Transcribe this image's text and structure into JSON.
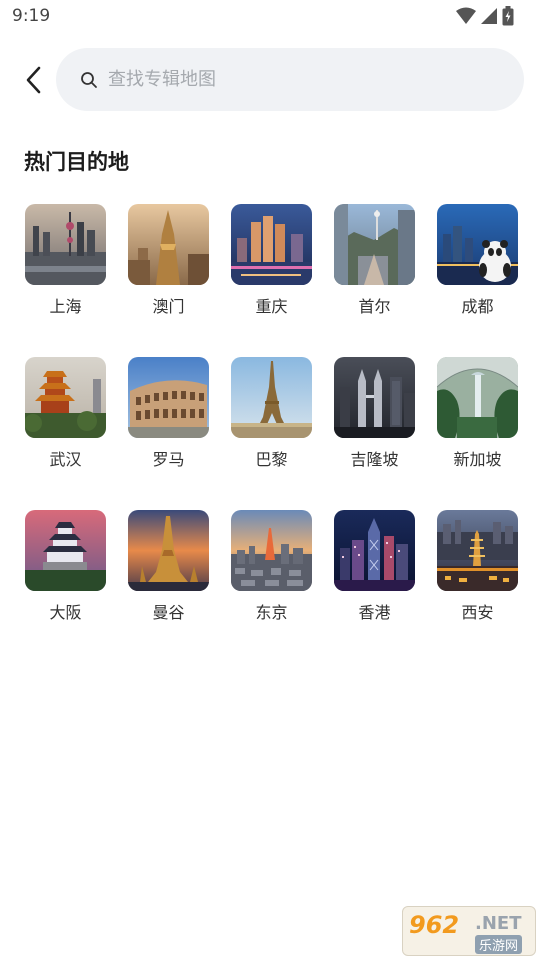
{
  "status_bar": {
    "time": "9:19"
  },
  "search": {
    "placeholder": "查找专辑地图",
    "value": ""
  },
  "section": {
    "title": "热门目的地"
  },
  "destinations": [
    {
      "name": "上海"
    },
    {
      "name": "澳门"
    },
    {
      "name": "重庆"
    },
    {
      "name": "首尔"
    },
    {
      "name": "成都"
    },
    {
      "name": "武汉"
    },
    {
      "name": "罗马"
    },
    {
      "name": "巴黎"
    },
    {
      "name": "吉隆坡"
    },
    {
      "name": "新加坡"
    },
    {
      "name": "大阪"
    },
    {
      "name": "曼谷"
    },
    {
      "name": "东京"
    },
    {
      "name": "香港"
    },
    {
      "name": "西安"
    }
  ],
  "watermark": {
    "number": "962",
    "suffix": ".NET",
    "site": "乐游网"
  },
  "colors": {
    "search_bg": "#f0f2f5",
    "placeholder": "#a5a9ae",
    "title": "#1c1c1c"
  }
}
